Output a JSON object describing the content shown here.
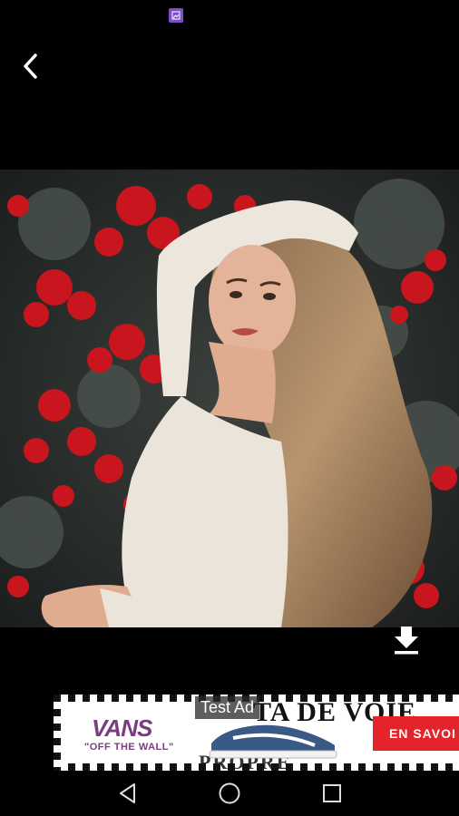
{
  "status_bar": {
    "notification_icon": "gallery-icon"
  },
  "toolbar": {
    "back_icon": "back-arrow-icon"
  },
  "photo": {
    "description_icon": "photo"
  },
  "actions": {
    "download_icon": "download-icon"
  },
  "ad": {
    "badge": "Test Ad",
    "brand": "VANS",
    "tagline": "\"OFF THE WALL\"",
    "headline": "TA DE VOIE",
    "headline_bottom": "PROPRE",
    "cta": "EN SAVOI"
  },
  "nav_bar": {
    "back": "nav-back-icon",
    "home": "nav-home-icon",
    "recents": "nav-recents-icon"
  },
  "colors": {
    "background": "#000000",
    "ad_cta": "#e3242b",
    "brand_purple": "#7a3d7f"
  }
}
